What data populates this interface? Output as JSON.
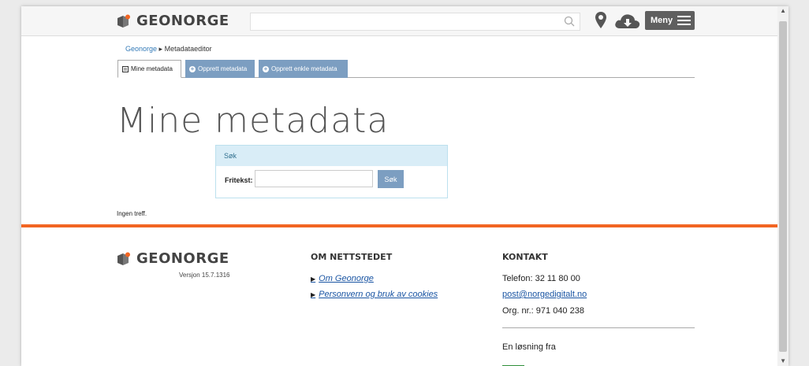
{
  "header": {
    "logo_text": "GEONORGE",
    "search_placeholder": "",
    "menu_label": "Meny"
  },
  "breadcrumb": {
    "home": "Geonorge",
    "separator": "▸",
    "current": "Metadataeditor"
  },
  "tabs": [
    {
      "label": "Mine metadata",
      "active": true
    },
    {
      "label": "Opprett metadata",
      "active": false
    },
    {
      "label": "Opprett enkle metadata",
      "active": false
    }
  ],
  "page_title": "Mine metadata",
  "search_panel": {
    "heading": "Søk",
    "field_label": "Fritekst:",
    "field_value": "",
    "button_label": "Søk"
  },
  "results_text": "Ingen treff.",
  "footer": {
    "logo_text": "GEONORGE",
    "version": "Versjon 15.7.1316",
    "about": {
      "title": "OM NETTSTEDET",
      "links": [
        "Om Geonorge",
        "Personvern og bruk av cookies"
      ]
    },
    "contact": {
      "title": "KONTAKT",
      "phone": "Telefon: 32 11 80 00",
      "email": "post@norgedigitalt.no",
      "org": "Org. nr.: 971 040 238",
      "solution_from": "En løsning fra"
    }
  },
  "colors": {
    "accent_orange": "#f26522",
    "tab_blue": "#7c9ec1",
    "panel_head": "#d9edf7",
    "logo_orange": "#f26522"
  },
  "icons": [
    "logo-icon",
    "search-icon",
    "map-pin-icon",
    "cloud-download-icon",
    "hamburger-icon",
    "plus-circle-icon",
    "list-icon"
  ]
}
